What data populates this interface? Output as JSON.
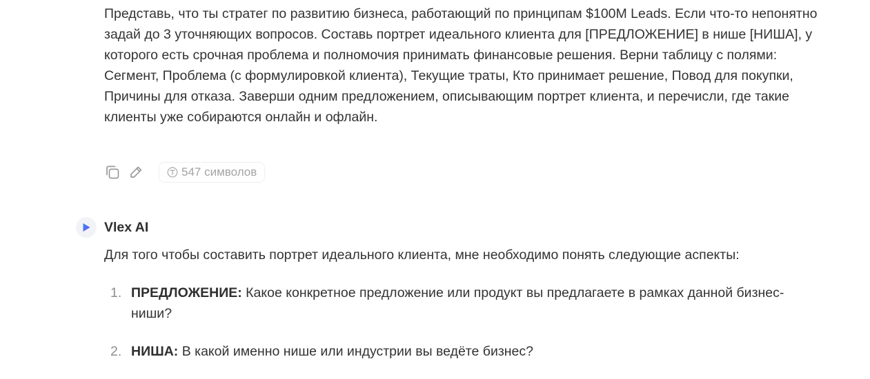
{
  "user_message": {
    "text": "Представь, что ты стратег по развитию бизнеса, работающий по принципам $100M Leads. Если что-то непонятно задай до 3 уточняющих вопросов. Составь портрет идеального клиента для [ПРЕДЛОЖЕНИЕ] в нише [НИША], у которого есть срочная проблема и полномочия принимать финансовые решения. Верни таблицу с полями: Сегмент, Проблема (с формулировкой клиента), Текущие траты, Кто принимает решение, Повод для покупки, Причины для отказа. Заверши одним предложением, описывающим портрет клиента, и перечисли, где такие клиенты уже собираются онлайн и офлайн.",
    "actions": {
      "copy_icon": "copy-icon",
      "edit_icon": "pencil-icon",
      "char_count_label": "547 символов"
    }
  },
  "assistant": {
    "name": "Vlex AI",
    "avatar_icon": "play-logo-icon",
    "intro": "Для того чтобы составить портрет идеального клиента, мне необходимо понять следующие аспекты:",
    "list": [
      {
        "number": "1.",
        "term": "ПРЕДЛОЖЕНИЕ:",
        "text": " Какое конкретное предложение или продукт вы предлагаете в рамках данной бизнес-ниши?"
      },
      {
        "number": "2.",
        "term": "НИША:",
        "text": " В какой именно нише или индустрии вы ведёте бизнес?"
      }
    ]
  },
  "colors": {
    "text": "#333333",
    "muted": "#a3a3a3",
    "logo_blue": "#3b6ff5",
    "logo_purple": "#7b4df0"
  }
}
